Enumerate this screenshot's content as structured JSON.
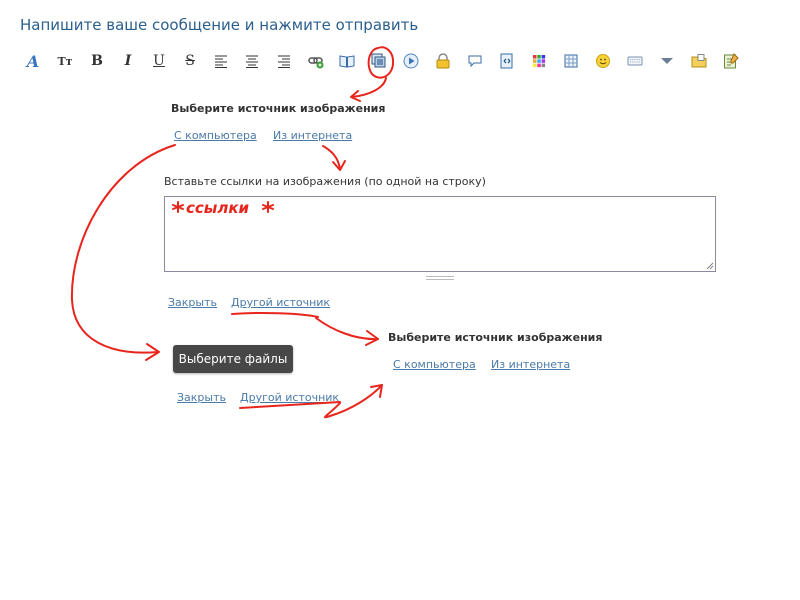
{
  "header": {
    "title": "Напишите ваше сообщение и нажмите отправить"
  },
  "toolbar": {
    "items": [
      {
        "icon": "font-style-icon",
        "glyph": "A"
      },
      {
        "icon": "font-size-icon",
        "glyph": "Tт"
      },
      {
        "icon": "bold-icon",
        "glyph": "B"
      },
      {
        "icon": "italic-icon",
        "glyph": "I"
      },
      {
        "icon": "underline-icon",
        "glyph": "U"
      },
      {
        "icon": "strikethrough-icon",
        "glyph": "S"
      },
      {
        "icon": "align-left-icon",
        "glyph": ""
      },
      {
        "icon": "align-center-icon",
        "glyph": ""
      },
      {
        "icon": "align-right-icon",
        "glyph": ""
      },
      {
        "icon": "link-icon",
        "glyph": ""
      },
      {
        "icon": "book-icon",
        "glyph": ""
      },
      {
        "icon": "image-icon",
        "glyph": ""
      },
      {
        "icon": "video-icon",
        "glyph": ""
      },
      {
        "icon": "lock-icon",
        "glyph": ""
      },
      {
        "icon": "speech-bubble-icon",
        "glyph": ""
      },
      {
        "icon": "code-icon",
        "glyph": ""
      },
      {
        "icon": "color-palette-icon",
        "glyph": ""
      },
      {
        "icon": "table-icon",
        "glyph": ""
      },
      {
        "icon": "smiley-icon",
        "glyph": ""
      },
      {
        "icon": "keyboard-icon",
        "glyph": ""
      },
      {
        "icon": "more-dropdown-icon",
        "glyph": ""
      },
      {
        "icon": "folder-icon",
        "glyph": ""
      },
      {
        "icon": "notes-icon",
        "glyph": ""
      }
    ]
  },
  "panel1": {
    "title": "Выберите источник изображения",
    "from_computer": "С компьютера",
    "from_internet": "Из интернета"
  },
  "url_panel": {
    "label": "Вставьте ссылки на изображения (по одной на строку)",
    "annotation_text": "*ссылки*",
    "close": "Закрыть",
    "other_source": "Другой источник"
  },
  "panel2": {
    "title": "Выберите источник изображения",
    "from_computer": "С компьютера",
    "from_internet": "Из интернета"
  },
  "file_panel": {
    "choose_files": "Выберите файлы",
    "close": "Закрыть",
    "other_source": "Другой источник"
  },
  "colors": {
    "link": "#4a7aa8",
    "title": "#2b5f8c",
    "annotation": "#e8251c",
    "button": "#474747"
  }
}
